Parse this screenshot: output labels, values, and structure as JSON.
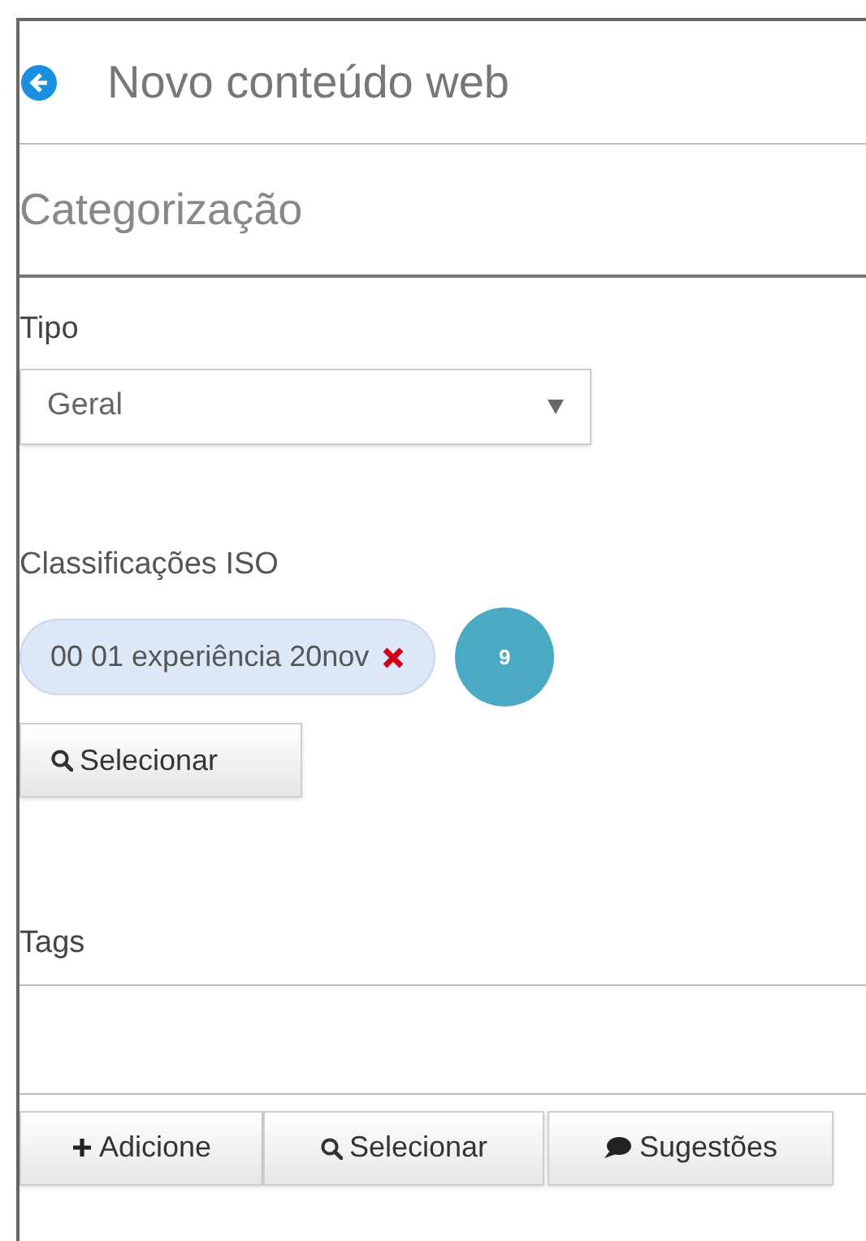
{
  "header": {
    "title": "Novo conteúdo web"
  },
  "section": {
    "title": "Categorização"
  },
  "tipo": {
    "label": "Tipo",
    "value": "Geral"
  },
  "iso": {
    "label": "Classificações ISO",
    "chips": [
      {
        "text": "00 01 experiência 20nov"
      }
    ],
    "badge": "9",
    "button": "Selecionar"
  },
  "tags": {
    "label": "Tags",
    "buttons": [
      {
        "kind": "add",
        "label": "Adicione"
      },
      {
        "kind": "search",
        "label": "Selecionar"
      },
      {
        "kind": "suggest",
        "label": "Sugestões"
      }
    ]
  }
}
